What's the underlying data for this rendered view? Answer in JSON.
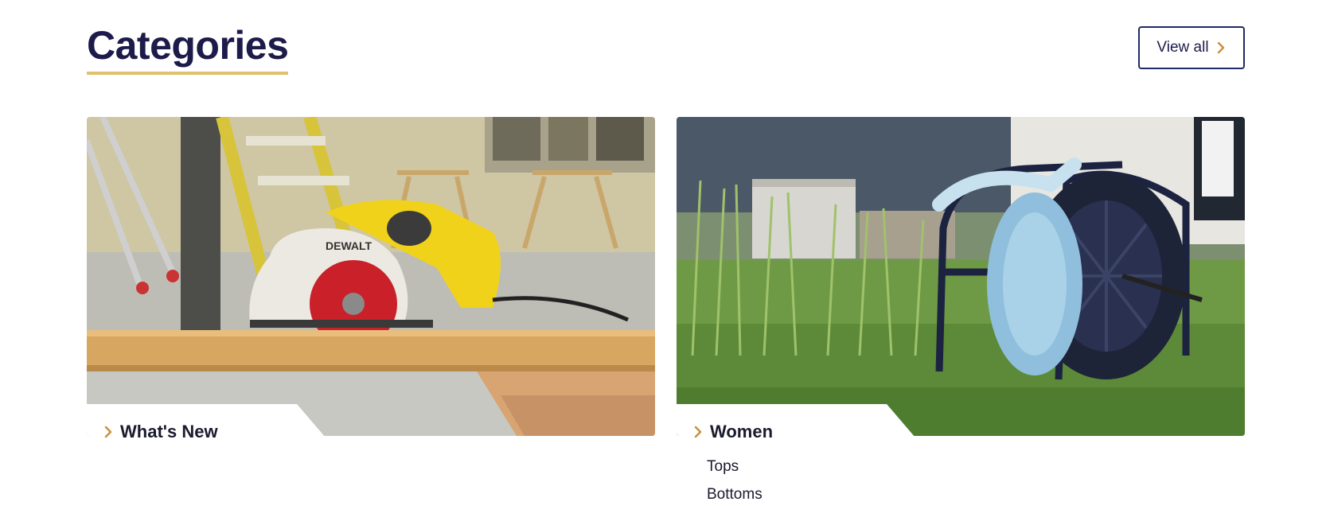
{
  "section": {
    "title": "Categories",
    "view_all_label": "View all"
  },
  "colors": {
    "heading": "#1c1b4a",
    "accent_underline": "#e2c06f",
    "chevron": "#c9913e",
    "button_border": "#1f2a66"
  },
  "icons": {
    "chevron": "chevron-right-icon"
  },
  "categories": [
    {
      "name": "What's New",
      "image_subject": "circular-saw-photo",
      "subcategories": []
    },
    {
      "name": "Women",
      "image_subject": "hose-reel-photo",
      "subcategories": [
        "Tops",
        "Bottoms"
      ]
    }
  ]
}
